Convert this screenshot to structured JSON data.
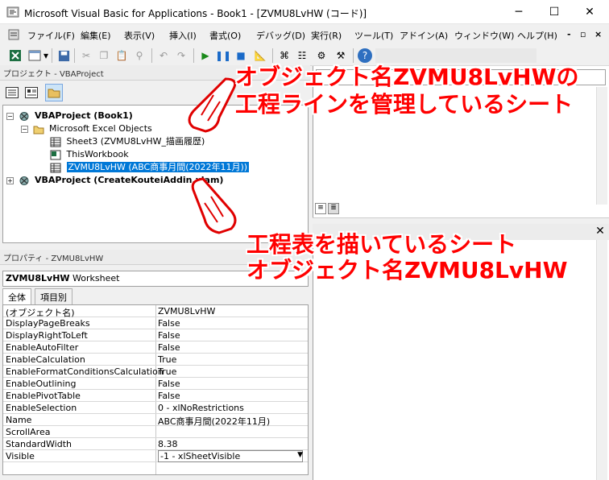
{
  "window": {
    "title": "Microsoft Visual Basic for Applications - Book1 - [ZVMU8LvHW (コード)]",
    "minimize": "─",
    "maximize": "☐",
    "close": "✕"
  },
  "menu": {
    "items": [
      "ファイル(F)",
      "編集(E)",
      "表示(V)",
      "挿入(I)",
      "書式(O)",
      "デバッグ(D)",
      "実行(R)",
      "ツール(T)",
      "アドイン(A)",
      "ウィンドウ(W)",
      "ヘルプ(H)"
    ],
    "controls": [
      "-",
      "▫",
      "×"
    ]
  },
  "project": {
    "pane_title": "プロジェクト - VBAProject",
    "tree": [
      {
        "label": "VBAProject (Book1)",
        "bold": true
      },
      {
        "label": "Microsoft Excel Objects",
        "bold": false
      },
      {
        "label": "Sheet3 (ZVMU8LvHW_描画履歴)",
        "bold": false
      },
      {
        "label": "ThisWorkbook",
        "bold": false
      },
      {
        "label": "ZVMU8LvHW (ABC商事月間(2022年11月))",
        "bold": false,
        "selected": true
      },
      {
        "label": "VBAProject (CreateKouteiAddin.xlam)",
        "bold": true
      }
    ]
  },
  "properties": {
    "pane_title": "プロパティ - ZVMU8LvHW",
    "object_name": "ZVMU8LvHW",
    "object_type": "Worksheet",
    "tabs": [
      "全体",
      "項目別"
    ],
    "rows": [
      {
        "name": "(オブジェクト名)",
        "value": "ZVMU8LvHW"
      },
      {
        "name": "DisplayPageBreaks",
        "value": "False"
      },
      {
        "name": "DisplayRightToLeft",
        "value": "False"
      },
      {
        "name": "EnableAutoFilter",
        "value": "False"
      },
      {
        "name": "EnableCalculation",
        "value": "True"
      },
      {
        "name": "EnableFormatConditionsCalculation",
        "value": "True"
      },
      {
        "name": "EnableOutlining",
        "value": "False"
      },
      {
        "name": "EnablePivotTable",
        "value": "False"
      },
      {
        "name": "EnableSelection",
        "value": "0 - xlNoRestrictions"
      },
      {
        "name": "Name",
        "value": "ABC商事月間(2022年11月)"
      },
      {
        "name": "ScrollArea",
        "value": ""
      },
      {
        "name": "StandardWidth",
        "value": "8.38"
      },
      {
        "name": "Visible",
        "value": "-1 - xlSheetVisible"
      }
    ]
  },
  "annotations": {
    "top_line1": "オブジェクト名ZVMU8LvHWの",
    "top_line2": "工程ラインを管理しているシート",
    "bottom_line1": "工程表を描いているシート",
    "bottom_line2": "オブジェクト名ZVMU8LvHW"
  },
  "colors": {
    "annotation": "#ff0000",
    "selection": "#0078d7"
  }
}
